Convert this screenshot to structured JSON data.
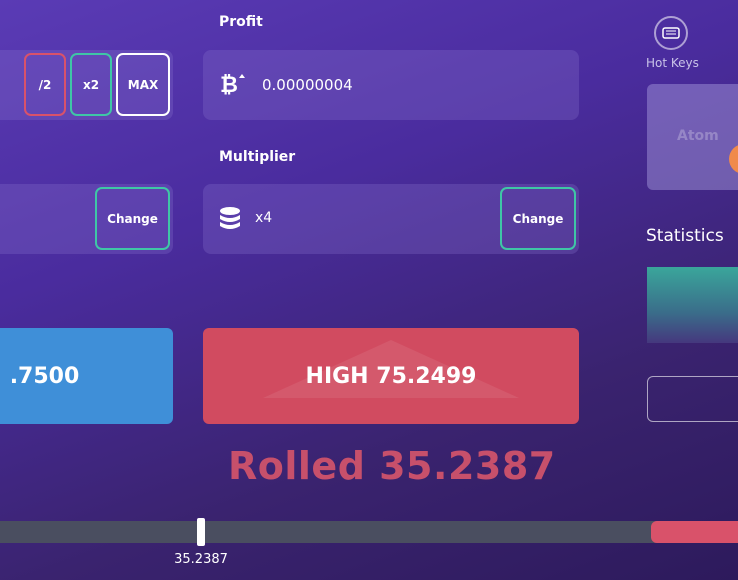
{
  "labels": {
    "profit": "Profit",
    "multiplier": "Multiplier",
    "hot_keys": "Hot Keys",
    "statistics": "Statistics",
    "overlay_word": "Atom"
  },
  "bet_controls": {
    "half": "/2",
    "double": "x2",
    "max": "MAX"
  },
  "profit_field": {
    "value": "0.00000004",
    "icon": "bitcoin-icon"
  },
  "multiplier_field": {
    "value": "x4",
    "icon": "coins-icon"
  },
  "change_buttons": {
    "left": "Change",
    "right": "Change"
  },
  "bets": {
    "low_label": ".7500",
    "high_label": "HIGH 75.2499"
  },
  "result": {
    "rolled_text": "Rolled 35.2387",
    "marker_value": "35.2387",
    "slider_fraction": 0.352387
  },
  "colors": {
    "high": "#d14b60",
    "low": "#3f8fd8",
    "accent_green": "#3fc6a6",
    "accent_red": "#d9526a",
    "rolled_text": "#c7506b"
  }
}
